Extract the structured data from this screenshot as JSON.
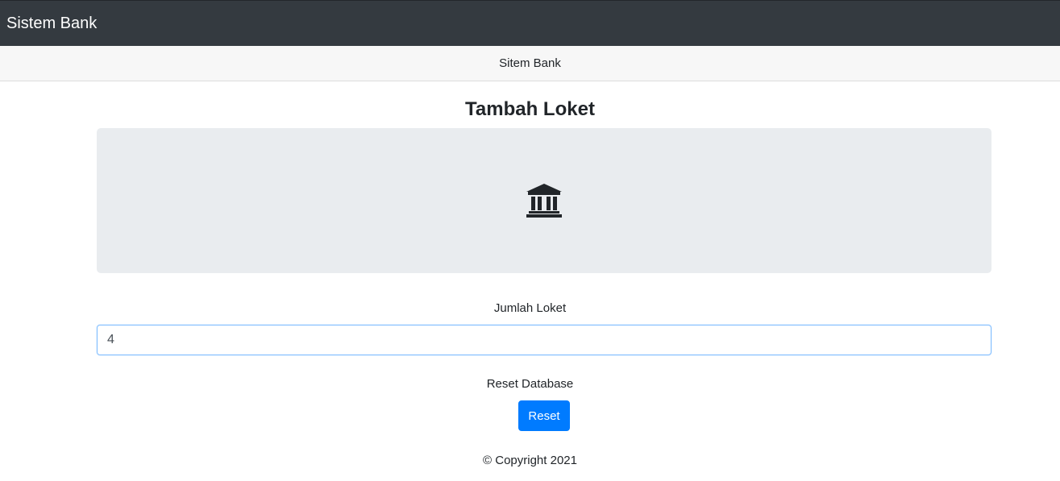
{
  "navbar": {
    "brand": "Sistem Bank"
  },
  "subbar": {
    "title": "Sitem Bank"
  },
  "main": {
    "title": "Tambah Loket",
    "jumbotron": {
      "icon": "bank-icon"
    },
    "jumlah_loket": {
      "label": "Jumlah Loket",
      "value": "4"
    },
    "reset": {
      "label": "Reset Database",
      "button_label": "Reset",
      "button_color": "#007bff"
    }
  },
  "footer": {
    "text": "© Copyright 2021"
  }
}
